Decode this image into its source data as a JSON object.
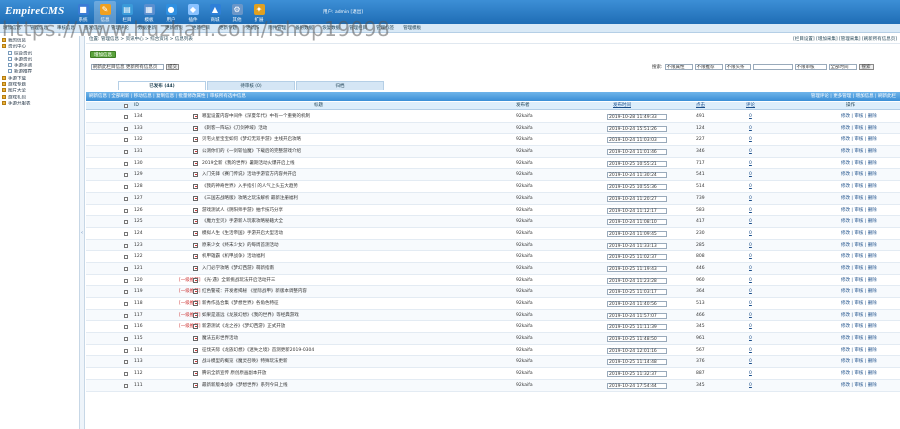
{
  "app": {
    "logo": "EmpireCMS",
    "nav": [
      {
        "label": "系统",
        "icon": "system-icon",
        "color": "#3a7bd5"
      },
      {
        "label": "信息",
        "icon": "info-icon",
        "color": "#f0a020"
      },
      {
        "label": "栏目",
        "icon": "column-icon",
        "color": "#3a9ad9"
      },
      {
        "label": "模板",
        "icon": "template-icon",
        "color": "#5a8fd0"
      },
      {
        "label": "用户",
        "icon": "user-icon",
        "color": "#2f8fe0"
      },
      {
        "label": "插件",
        "icon": "plugin-icon",
        "color": "#8ac2ff"
      },
      {
        "label": "商城",
        "icon": "shop-icon",
        "color": "#2e7fd8"
      },
      {
        "label": "其他",
        "icon": "gear-icon",
        "color": "#6a96c8"
      },
      {
        "label": "扩展",
        "icon": "extend-icon",
        "color": "#e0a020"
      }
    ],
    "active_nav": 1,
    "userinfo": "用户: admin  [退出]"
  },
  "subbar": [
    "增加信息",
    "管理信息",
    "审核信息",
    "签发信息",
    "管理评论",
    "数据更新",
    "更新首页",
    "更新栏目",
    "更新专题",
    "更新JS",
    "附件管理",
    "备份数据",
    "恢复数据",
    "管理栏目",
    "管理标签",
    "管理模板"
  ],
  "watermark": "https://www.huzhan.com/ishop19098",
  "left_tree": [
    {
      "label": "我的信息",
      "level": 0
    },
    {
      "label": "资讯中心",
      "level": 0
    },
    {
      "label": "综合资讯",
      "level": 1
    },
    {
      "label": "手游资讯",
      "level": 1
    },
    {
      "label": "手游评测",
      "level": 1
    },
    {
      "label": "新游推荐",
      "level": 1
    },
    {
      "label": "手游下载",
      "level": 0
    },
    {
      "label": "游戏专题",
      "level": 0
    },
    {
      "label": "图片大全",
      "level": 0
    },
    {
      "label": "游戏礼包",
      "level": 0
    },
    {
      "label": "手游开服表",
      "level": 0
    }
  ],
  "breadcrumb": "位置: 管理信息 > 资讯中心 > 综合资讯 > 信息列表",
  "top_links": "[栏目设置] [增加采集] [管理采集] [刷新所有信息页]",
  "add_button": "增加信息",
  "left_select": "刷新此栏目信息  更新所有信息页",
  "left_go": "提交",
  "search": {
    "label": "搜索:",
    "selects": [
      "不限属性",
      "不限推荐",
      "不限头条",
      "不限审核",
      "全部时间"
    ],
    "button": "搜索"
  },
  "tabs": [
    "已发布 (44)",
    "待审核 (0)",
    "归档"
  ],
  "active_tab": 0,
  "action_bar": "刷新信息 | 全部刷新 | 移动信息 | 复制信息 | 批量修改属性 | 审核所有选中信息",
  "action_right": "管理评论 | 更多管理 | 增加信息 | 刷新此栏",
  "columns": {
    "id": "ID",
    "title": "标题",
    "author": "发布者",
    "time": "发布时间",
    "hits": "点击",
    "comments": "评论",
    "ops": "操作"
  },
  "rows": [
    {
      "id": "134",
      "tag": "",
      "title": "哪里设置内容中间件《深夏年代》中有一个重要的机制",
      "author": "92kaifa",
      "time": "2019-10-28 11:49:33",
      "hits": "491",
      "comments": "0",
      "ops": "修改 | 审核 | 删除"
    },
    {
      "id": "133",
      "tag": "",
      "title": "《刺客一阵坛》《刀剑神域》活动",
      "author": "92kaifa",
      "time": "2019-10-24 15:51:26",
      "hits": "124",
      "comments": "0",
      "ops": "修改 | 审核 | 删除"
    },
    {
      "id": "132",
      "tag": "",
      "title": "贝宅火星宝宝如何《梦幻无双手游》主线开启攻略",
      "author": "92kaifa",
      "time": "2019-10-24 11:03:03",
      "hits": "227",
      "comments": "0",
      "ops": "修改 | 审核 | 删除"
    },
    {
      "id": "131",
      "tag": "",
      "title": "公测你们的《一剑斩仙魔》下载后的完整游戏介绍",
      "author": "92kaifa",
      "time": "2019-10-24 11:01:46",
      "hits": "346",
      "comments": "0",
      "ops": "修改 | 审核 | 删除"
    },
    {
      "id": "130",
      "tag": "",
      "title": "2019全新《我的世界》暑期活动火爆开启上线",
      "author": "92kaifa",
      "time": "2019-10-25 10:55:21",
      "hits": "717",
      "comments": "0",
      "ops": "修改 | 审核 | 删除"
    },
    {
      "id": "129",
      "tag": "",
      "title": "入门先锋《赛门传说》活动手游官方内容共开启",
      "author": "92kaifa",
      "time": "2019-10-24 11:30:24",
      "hits": "541",
      "comments": "0",
      "ops": "修改 | 审核 | 删除"
    },
    {
      "id": "128",
      "tag": "",
      "title": "《我的神奇世界》入手指引 的人气上头五大趋势",
      "author": "92kaifa",
      "time": "2019-10-25 10:55:36",
      "hits": "514",
      "comments": "0",
      "ops": "修改 | 审核 | 删除"
    },
    {
      "id": "127",
      "tag": "",
      "title": "《三国志战略版》攻略之玩法解析 最新注册福利",
      "author": "92kaifa",
      "time": "2019-10-24 11:20:27",
      "hits": "739",
      "comments": "0",
      "ops": "修改 | 审核 | 删除"
    },
    {
      "id": "126",
      "tag": "",
      "title": "游戏测试人《阴阳师手游》抽卡技巧分享",
      "author": "92kaifa",
      "time": "2019-10-24 11:12:17",
      "hits": "583",
      "comments": "0",
      "ops": "修改 | 审核 | 删除"
    },
    {
      "id": "125",
      "tag": "",
      "title": "《魔力宝贝》手游新人玩家攻略秘籍大全",
      "author": "92kaifa",
      "time": "2019-10-24 11:08:10",
      "hits": "417",
      "comments": "0",
      "ops": "修改 | 审核 | 删除"
    },
    {
      "id": "124",
      "tag": "",
      "title": "模拟人生《生活帝国》手游开启大型活动",
      "author": "92kaifa",
      "time": "2019-10-24 11:09:45",
      "hits": "230",
      "comments": "0",
      "ops": "修改 | 审核 | 删除"
    },
    {
      "id": "123",
      "tag": "",
      "title": "原来少女《终末少女》的每周首测活动",
      "author": "92kaifa",
      "time": "2019-10-24 11:33:13",
      "hits": "285",
      "comments": "0",
      "ops": "修改 | 审核 | 删除"
    },
    {
      "id": "122",
      "tag": "",
      "title": "机甲雄霸《机甲战争》活动福利",
      "author": "92kaifa",
      "time": "2019-10-25 11:02:37",
      "hits": "808",
      "comments": "0",
      "ops": "修改 | 审核 | 删除"
    },
    {
      "id": "121",
      "tag": "",
      "title": "入门必学攻略《梦幻西游》萌新指南",
      "author": "92kaifa",
      "time": "2019-10-25 11:19:43",
      "hits": "446",
      "comments": "0",
      "ops": "修改 | 审核 | 删除"
    },
    {
      "id": "120",
      "tag": "[一级推荐]",
      "title": "《光·遇》全新挑战玩法开启活动开三",
      "author": "92kaifa",
      "time": "2019-10-24 11:23:28",
      "hits": "960",
      "comments": "0",
      "ops": "修改 | 审核 | 删除"
    },
    {
      "id": "119",
      "tag": "[一级推荐]",
      "title": "红色警戒：开发者揭秘 《星际战甲》新版本调整内容",
      "author": "92kaifa",
      "time": "2019-10-25 11:03:17",
      "hits": "364",
      "comments": "0",
      "ops": "修改 | 审核 | 删除"
    },
    {
      "id": "118",
      "tag": "[一级推荐]",
      "title": "新秀作品合集《梦想世界》各角色特征",
      "author": "92kaifa",
      "time": "2019-10-24 11:40:56",
      "hits": "513",
      "comments": "0",
      "ops": "修改 | 审核 | 删除"
    },
    {
      "id": "117",
      "tag": "[一级推荐]",
      "title": "如果是遥远《龙族幻想》《我的世界》等经典游戏",
      "author": "92kaifa",
      "time": "2019-10-24 11:57:07",
      "hits": "466",
      "comments": "0",
      "ops": "修改 | 审核 | 删除"
    },
    {
      "id": "116",
      "tag": "[一级推荐]",
      "title": "新游测试《龙之谷》《梦幻西游》正式开放",
      "author": "92kaifa",
      "time": "2019-10-25 11:11:39",
      "hits": "345",
      "comments": "0",
      "ops": "修改 | 审核 | 删除"
    },
    {
      "id": "115",
      "tag": "",
      "title": "魔法五彩世界活动",
      "author": "92kaifa",
      "time": "2019-10-25 11:48:50",
      "hits": "961",
      "comments": "0",
      "ops": "修改 | 审核 | 删除"
    },
    {
      "id": "114",
      "tag": "",
      "title": "征伐天际《龙族幻想》《迷失之境》首测更新2019-0304",
      "author": "92kaifa",
      "time": "2019-10-24 12:01:16",
      "hits": "567",
      "comments": "0",
      "ops": "修改 | 审核 | 删除"
    },
    {
      "id": "113",
      "tag": "",
      "title": "战斗模型的概览《魔灵召唤》特殊玩法更新",
      "author": "92kaifa",
      "time": "2019-10-25 11:14:48",
      "hits": "376",
      "comments": "0",
      "ops": "修改 | 审核 | 删除"
    },
    {
      "id": "112",
      "tag": "",
      "title": "腾讯全新宣传 原创原画副本开放",
      "author": "92kaifa",
      "time": "2019-10-25 11:32:37",
      "hits": "887",
      "comments": "0",
      "ops": "修改 | 审核 | 删除"
    },
    {
      "id": "111",
      "tag": "",
      "title": "最新新版本战争《梦想世界》系列今日上线",
      "author": "92kaifa",
      "time": "2019-10-24 17:54:44",
      "hits": "345",
      "comments": "0",
      "ops": "修改 | 审核 | 删除"
    }
  ]
}
